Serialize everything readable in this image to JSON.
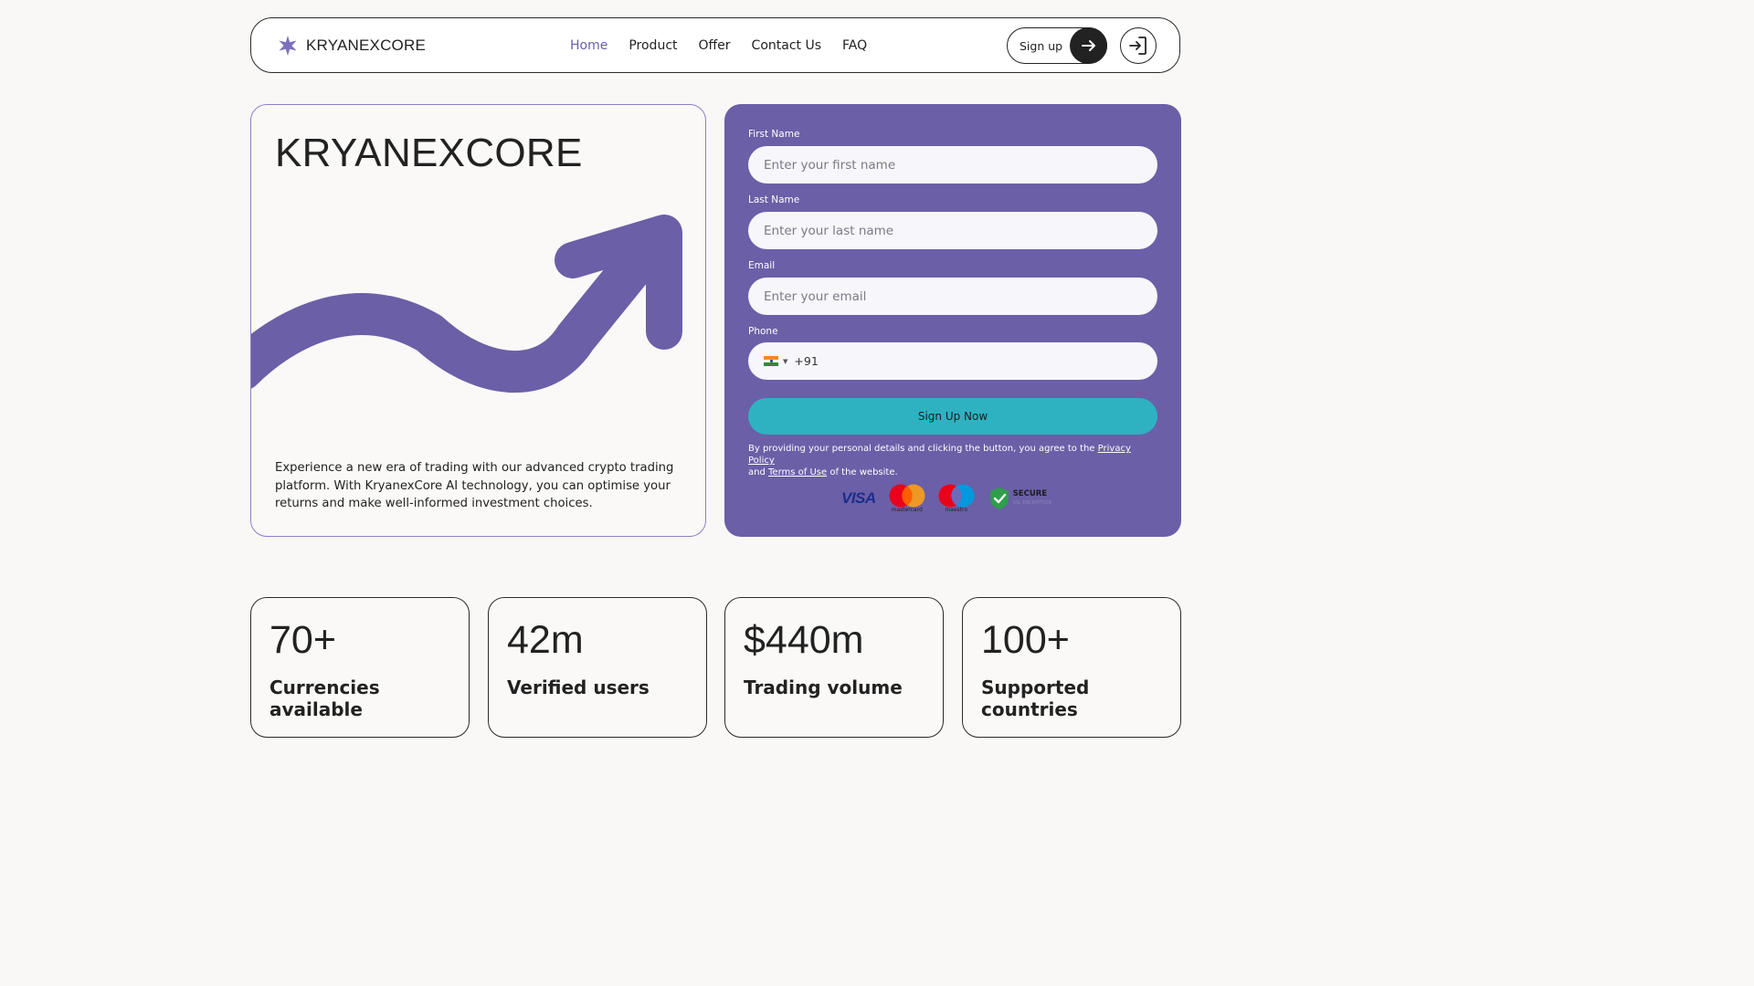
{
  "brand": {
    "name": "KRYANEXCORE",
    "accent": "#6b5fa7",
    "logo_icon": "star-icon"
  },
  "nav": {
    "items": [
      {
        "label": "Home",
        "active": true
      },
      {
        "label": "Product",
        "active": false
      },
      {
        "label": "Offer",
        "active": false
      },
      {
        "label": "Contact Us",
        "active": false
      },
      {
        "label": "FAQ",
        "active": false
      }
    ]
  },
  "header": {
    "signup_label": "Sign up",
    "signup_icon": "arrow-right-icon",
    "login_icon": "login-icon"
  },
  "hero": {
    "title": "KRYANEXCORE",
    "description": "Experience a new era of trading with our advanced crypto trading platform. With KryanexCore AI technology, you can optimise your returns and make well-informed investment choices.",
    "graphic": "trend-arrow-icon"
  },
  "form": {
    "first_name": {
      "label": "First Name",
      "placeholder": "Enter your first name"
    },
    "last_name": {
      "label": "Last Name",
      "placeholder": "Enter your last name"
    },
    "email": {
      "label": "Email",
      "placeholder": "Enter your email"
    },
    "phone": {
      "label": "Phone",
      "dial_code": "+91",
      "flag": "india-flag-icon"
    },
    "submit_label": "Sign Up Now",
    "submit_color": "#2eb2c1",
    "legal": {
      "prefix": "By providing your personal details and clicking the button, you agree to the",
      "privacy": "Privacy Policy",
      "and": "and",
      "terms": "Terms of Use",
      "suffix": "of the website."
    },
    "badges": {
      "visa": "VISA",
      "mastercard": "mastercard",
      "maestro": "maestro",
      "secure": "SECURE",
      "secure_sub": "SSL ENCRYPTION"
    }
  },
  "stats": [
    {
      "value": "70+",
      "label": "Currencies available"
    },
    {
      "value": "42m",
      "label": "Verified users"
    },
    {
      "value": "$440m",
      "label": "Trading volume"
    },
    {
      "value": "100+",
      "label": "Supported countries"
    }
  ]
}
